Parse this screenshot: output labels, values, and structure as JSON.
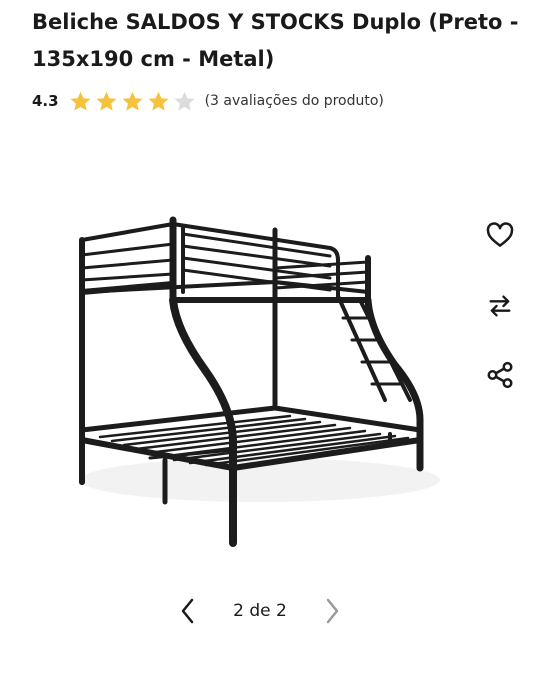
{
  "product": {
    "title": "Beliche SALDOS Y STOCKS Duplo (Preto - 135x190 cm - Metal)"
  },
  "rating": {
    "score": "4.3",
    "stars_filled": 4,
    "stars_total": 5,
    "count_text": "(3 avaliações do produto)",
    "star_color": "#f6c23e",
    "star_empty_color": "#dcdcdc"
  },
  "actions": {
    "favorite_icon": "heart-icon",
    "compare_icon": "swap-arrows-icon",
    "share_icon": "share-icon"
  },
  "gallery": {
    "image_alt": "bunk-bed-black-metal",
    "pager_text": "2 de 2",
    "prev_icon": "chevron-left-icon",
    "next_icon": "chevron-right-icon"
  }
}
